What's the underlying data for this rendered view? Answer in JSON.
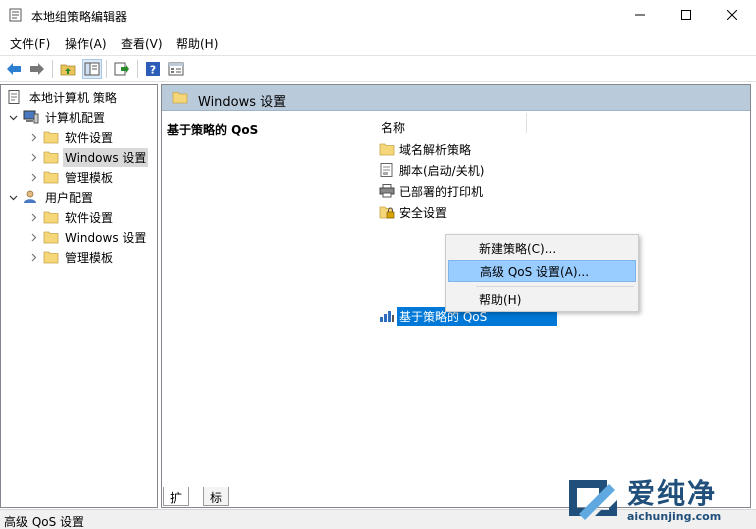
{
  "window": {
    "title": "本地组策略编辑器"
  },
  "menu": {
    "items": [
      "文件(F)",
      "操作(A)",
      "查看(V)",
      "帮助(H)"
    ]
  },
  "toolbar": {
    "buttons": [
      "back-arrow-icon",
      "forward-arrow-icon",
      "up-folder-icon",
      "show-hide-tree-icon",
      "export-list-icon",
      "help-icon",
      "properties-icon"
    ]
  },
  "tree": {
    "root": "本地计算机 策略",
    "computer_config": "计算机配置",
    "computer_children": [
      "软件设置",
      "Windows 设置",
      "管理模板"
    ],
    "user_config": "用户配置",
    "user_children": [
      "软件设置",
      "Windows 设置",
      "管理模板"
    ]
  },
  "right": {
    "header": "Windows 设置",
    "desc_title": "基于策略的 QoS",
    "column_name": "名称",
    "items": [
      "域名解析策略",
      "脚本(启动/关机)",
      "已部署的打印机",
      "安全设置",
      "基于策略的 QoS"
    ]
  },
  "context_menu": {
    "items": [
      "新建策略(C)...",
      "高级 QoS 设置(A)...",
      "帮助(H)"
    ]
  },
  "tabs": [
    "扩展",
    "标准"
  ],
  "status": {
    "text": "高级 QoS 设置"
  },
  "watermark": {
    "text": "爱纯净",
    "url": "aichunjing.com"
  },
  "colors": {
    "selection": "#0078d7",
    "menu_highlight": "#99ccff",
    "header_band": "#b9cadb",
    "folder": "#f5d77a"
  }
}
